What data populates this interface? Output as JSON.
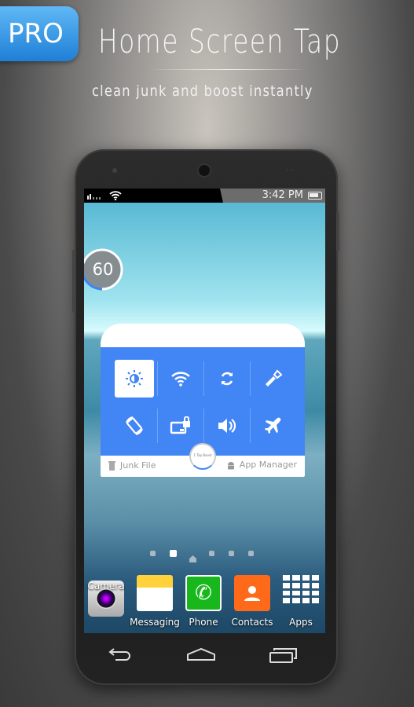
{
  "promo": {
    "badge": "PRO",
    "title": "Home Screen Tap",
    "subtitle": "clean junk and boost instantly"
  },
  "status_bar": {
    "time": "3:42 PM",
    "icons": [
      "signal-icon",
      "wifi-icon",
      "battery-icon"
    ]
  },
  "memory_gauge": {
    "value": "60",
    "percent": 60,
    "accent": "#3d86f0"
  },
  "widget": {
    "accent": "#4285f4",
    "toggles": [
      {
        "name": "brightness",
        "icon": "brightness-icon",
        "active": true
      },
      {
        "name": "wifi",
        "icon": "wifi-icon",
        "active": false
      },
      {
        "name": "sync",
        "icon": "sync-icon",
        "active": false
      },
      {
        "name": "flashlight",
        "icon": "flashlight-icon",
        "active": false
      },
      {
        "name": "rotation",
        "icon": "rotation-icon",
        "active": false
      },
      {
        "name": "screen-lock",
        "icon": "screen-lock-icon",
        "active": false
      },
      {
        "name": "sound",
        "icon": "volume-icon",
        "active": false
      },
      {
        "name": "airplane",
        "icon": "airplane-icon",
        "active": false
      }
    ],
    "junk_label": "Junk File",
    "boost_label": "1 Tap Boost",
    "app_manager_label": "App Manager"
  },
  "pager": {
    "pages": 6,
    "current": 2
  },
  "dock": [
    {
      "label": "Camera",
      "icon": "camera-icon"
    },
    {
      "label": "Messaging",
      "icon": "messaging-icon"
    },
    {
      "label": "Phone",
      "icon": "phone-icon"
    },
    {
      "label": "Contacts",
      "icon": "contacts-icon"
    },
    {
      "label": "Apps",
      "icon": "apps-grid-icon"
    }
  ],
  "nav": [
    "back-icon",
    "home-icon",
    "recents-icon"
  ]
}
